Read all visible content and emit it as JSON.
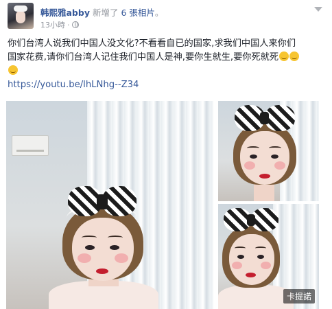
{
  "post": {
    "author_name": "韩熙雅abby",
    "action_prefix": "新增了",
    "photo_count": "6",
    "photo_word": "張相片",
    "action_suffix": "。",
    "timestamp": "13小時",
    "timestamp_sep": "·",
    "text_line1": "你们台湾人说我们中国人没文化?不看看自已的国家,求我们中国人来你们",
    "text_line2": "国家花费,请你们台湾人记住我们中国人是神,要你生就生,要你死就死",
    "link": "https://youtu.be/lhLNhg--Z34",
    "photo_overlay_label": "卡提諾",
    "icons": {
      "privacy": "globe-icon",
      "options": "chevron-down-icon",
      "emoji": "smirk-emoji-icon"
    },
    "colors": {
      "link": "#365899",
      "meta": "#90949c",
      "text": "#1d2129"
    }
  }
}
